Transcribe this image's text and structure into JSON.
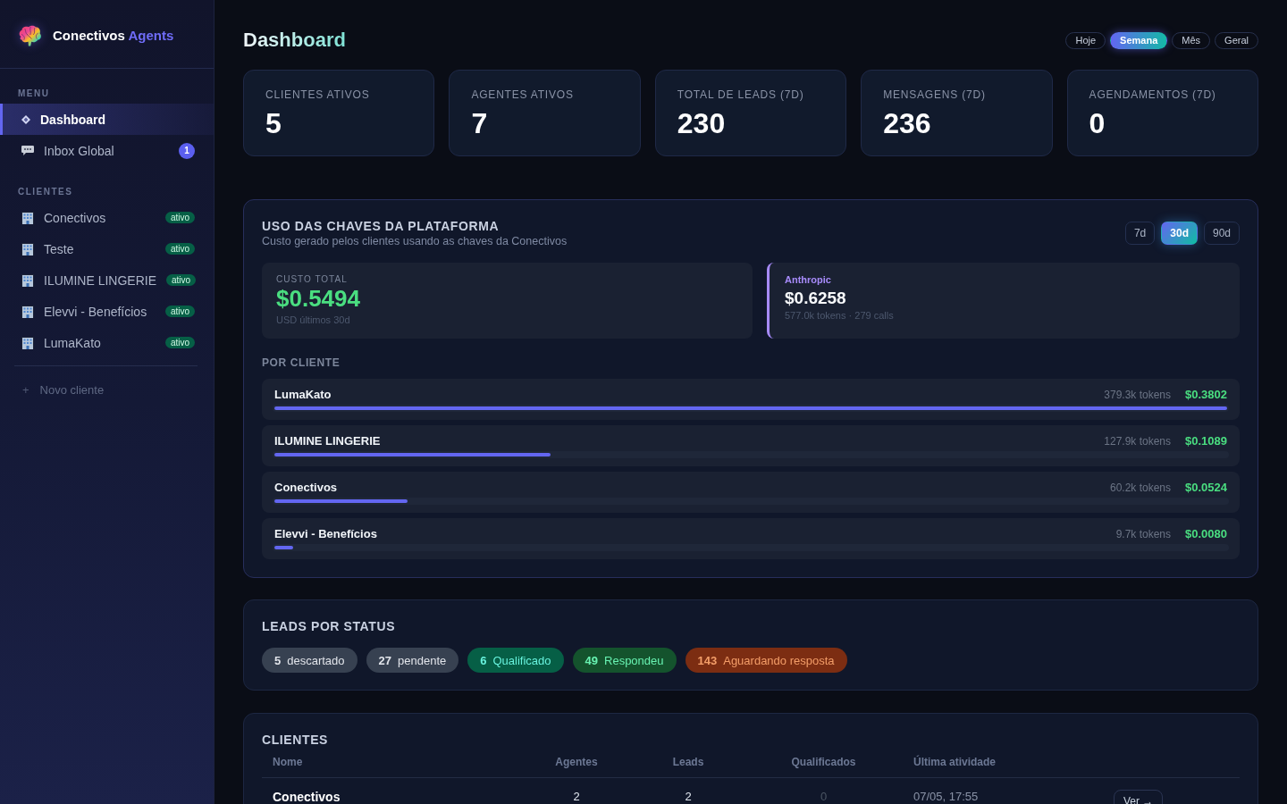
{
  "sidebar": {
    "brand": {
      "name": "Conectivos",
      "accent": "Agents"
    },
    "sections": [
      {
        "heading": "MENU",
        "items": [
          {
            "kind": "overview",
            "label": "Dashboard",
            "selected": true
          },
          {
            "kind": "inbox",
            "label": "Inbox Global",
            "selected": false,
            "badge": "1"
          }
        ]
      },
      {
        "heading": "CLIENTES",
        "items": [
          {
            "kind": "client",
            "label": "Conectivos",
            "selected": false,
            "badge": "ativo"
          },
          {
            "kind": "client",
            "label": "Teste",
            "selected": false,
            "badge": "ativo"
          },
          {
            "kind": "client",
            "label": "ILUMINE LINGERIE",
            "selected": false,
            "badge": "ativo"
          },
          {
            "kind": "client",
            "label": "Elevvi - Benefícios",
            "selected": false,
            "badge": "ativo"
          },
          {
            "kind": "client",
            "label": "LumaKato",
            "selected": false,
            "badge": "ativo"
          }
        ]
      }
    ],
    "new_client": {
      "glyph": "+",
      "label": "Novo cliente"
    }
  },
  "header": {
    "title": "Dashboard",
    "periods": [
      {
        "label": "Hoje",
        "selected": false
      },
      {
        "label": "Semana",
        "selected": true
      },
      {
        "label": "Mês",
        "selected": false
      },
      {
        "label": "Geral",
        "selected": false
      }
    ]
  },
  "stats": [
    {
      "label": "CLIENTES ATIVOS",
      "value": "5"
    },
    {
      "label": "AGENTES ATIVOS",
      "value": "7"
    },
    {
      "label": "TOTAL DE LEADS (7D)",
      "value": "230"
    },
    {
      "label": "MENSAGENS (7D)",
      "value": "236"
    },
    {
      "label": "AGENDAMENTOS (7D)",
      "value": "0"
    }
  ],
  "platform_usage": {
    "title": "USO DAS CHAVES DA PLATAFORMA",
    "subtitle": "Custo gerado pelos clientes usando as chaves da Conectivos",
    "ranges": [
      {
        "label": "7d",
        "selected": false
      },
      {
        "label": "30d",
        "selected": true
      },
      {
        "label": "90d",
        "selected": false
      }
    ],
    "total": {
      "label": "CUSTO TOTAL",
      "value": "$0.5494",
      "caption": "USD últimos 30d"
    },
    "providers": [
      {
        "name": "Anthropic",
        "value": "$0.6258",
        "caption": "577.0k tokens · 279 calls"
      }
    ],
    "per_client": {
      "heading": "POR CLIENTE",
      "rows": [
        {
          "name": "LumaKato",
          "tokens": "379.3k tokens",
          "cost": "$0.3802",
          "level": 1.0
        },
        {
          "name": "ILUMINE LINGERIE",
          "tokens": "127.9k tokens",
          "cost": "$0.1089",
          "level": 0.29
        },
        {
          "name": "Conectivos",
          "tokens": "60.2k tokens",
          "cost": "$0.0524",
          "level": 0.14
        },
        {
          "name": "Elevvi - Benefícios",
          "tokens": "9.7k tokens",
          "cost": "$0.0080",
          "level": 0.02
        }
      ]
    }
  },
  "leads_by_status": {
    "title": "LEADS POR STATUS",
    "statuses": [
      {
        "count": "5",
        "label": "descartado",
        "color": "#374151"
      },
      {
        "count": "27",
        "label": "pendente",
        "color": "#374151"
      },
      {
        "count": "6",
        "label": "Qualificado",
        "color": "#065f46"
      },
      {
        "count": "49",
        "label": "Respondeu",
        "color": "#14532d"
      },
      {
        "count": "143",
        "label": "Aguardando resposta",
        "color": "#7c2d12"
      }
    ]
  },
  "clients_table": {
    "title": "CLIENTES",
    "columns": [
      "Nome",
      "Agentes",
      "Leads",
      "Qualificados",
      "Última atividade"
    ],
    "rows": [
      {
        "cells": [
          {
            "text": "Conectivos",
            "muted": false
          },
          {
            "text": "2",
            "muted": false
          },
          {
            "text": "2",
            "muted": false
          },
          {
            "text": "0",
            "muted": true
          },
          {
            "text": "07/05, 17:55",
            "muted": false
          }
        ],
        "action": "Ver →"
      }
    ]
  }
}
